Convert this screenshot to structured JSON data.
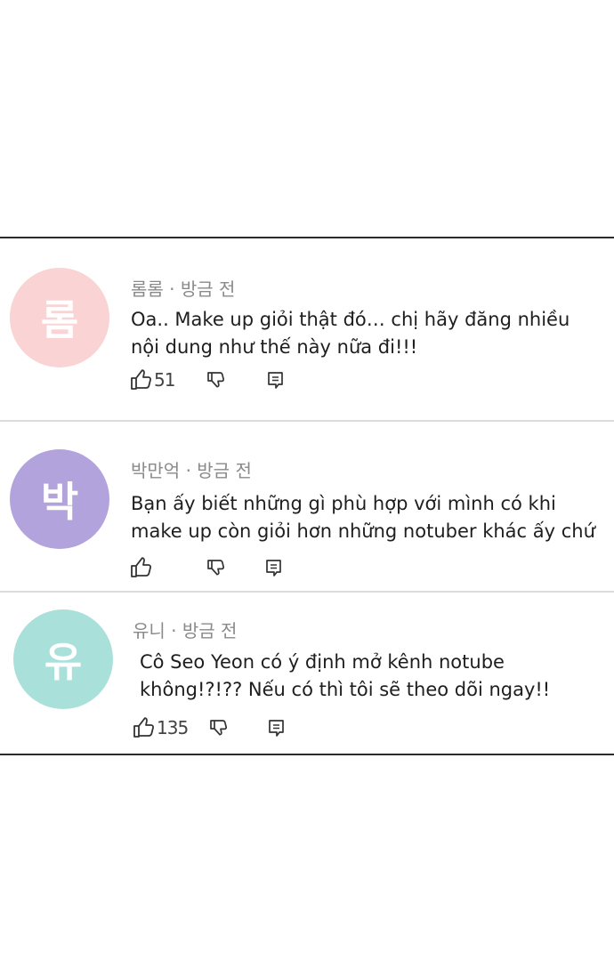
{
  "comments": [
    {
      "avatar_char": "롬",
      "avatar_color": "#fad3d4",
      "author": "롬롬",
      "time": "방금 전",
      "line1": "Oa.. Make up giỏi thật đó… chị hãy đăng nhiều",
      "line2": "nội dung như thế này nữa đi!!!",
      "likes": "51"
    },
    {
      "avatar_char": "박",
      "avatar_color": "#b3a3dd",
      "author": "박만억",
      "time": "방금 전",
      "line1": "Bạn ấy biết những gì phù hợp với mình có khi",
      "line2": "make up còn giỏi hơn những notuber khác ấy chứ",
      "likes": ""
    },
    {
      "avatar_char": "유",
      "avatar_color": "#a9e0d9",
      "author": "유니",
      "time": "방금 전",
      "line1": "Cô Seo Yeon có ý định mở kênh notube",
      "line2": "không!?!?? Nếu có thì tôi sẽ theo dõi ngay!!",
      "likes": "135"
    }
  ],
  "icons": {
    "like": "thumbs-up-icon",
    "dislike": "thumbs-down-icon",
    "reply": "reply-icon"
  }
}
